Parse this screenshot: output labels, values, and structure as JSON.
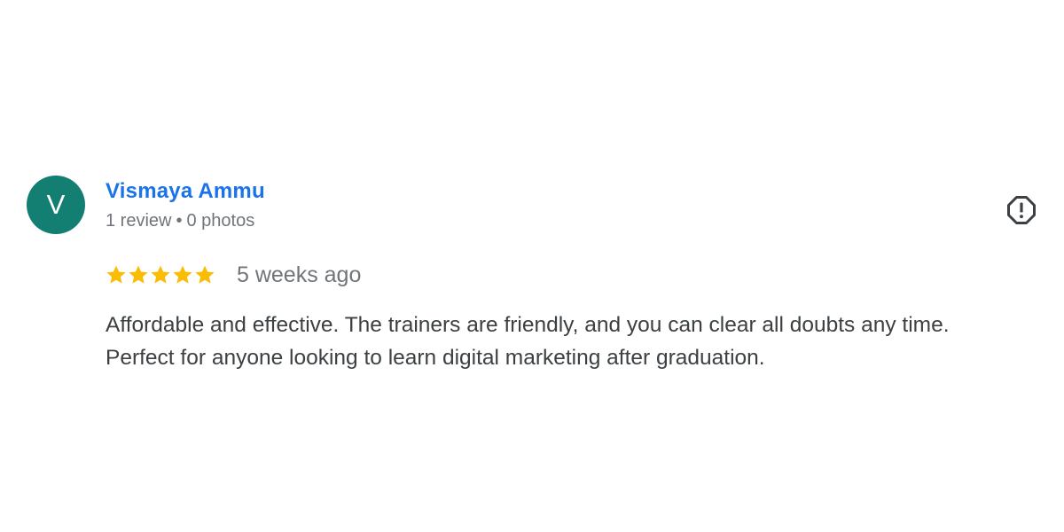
{
  "review": {
    "author": {
      "initial": "V",
      "name": "Vismaya Ammu",
      "review_count": "1 review",
      "separator": "•",
      "photo_count": "0 photos"
    },
    "rating": 5,
    "rating_max": 5,
    "time_ago": "5 weeks ago",
    "text_lines": [
      "Affordable and effective. The trainers are friendly, and you can clear all doubts any time.",
      "Perfect for anyone looking to learn digital marketing after graduation."
    ],
    "icons": {
      "star": "star-icon",
      "report": "flag-icon"
    }
  },
  "colors": {
    "avatar_bg": "#137e72",
    "author_name": "#1a73e8",
    "star": "#fbbc04",
    "meta_text": "#70757a",
    "body_text": "#3c4043",
    "report_icon": "#3c4043"
  }
}
